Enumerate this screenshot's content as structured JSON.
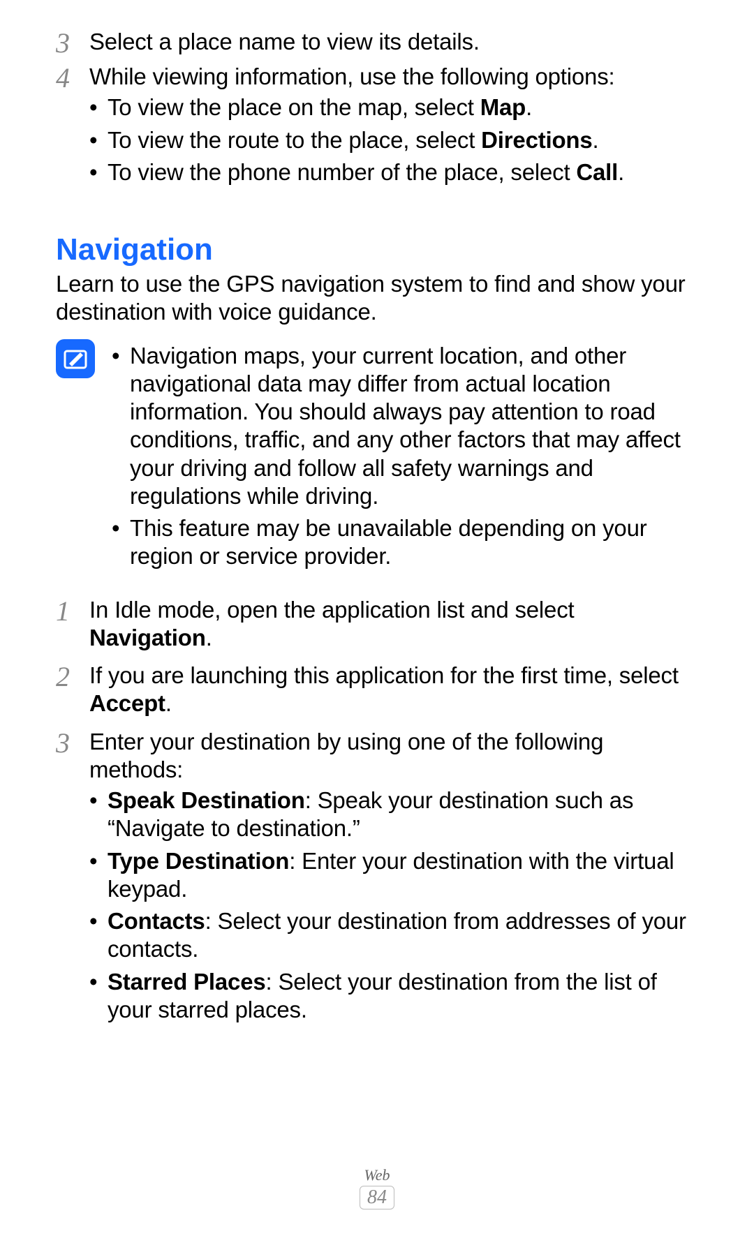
{
  "top_list": {
    "item3": {
      "num": "3",
      "text": "Select a place name to view its details."
    },
    "item4": {
      "num": "4",
      "text": "While viewing information, use the following options:",
      "bullets": {
        "b1": {
          "pre": "To view the place on the map, select ",
          "bold": "Map",
          "post": "."
        },
        "b2": {
          "pre": "To view the route to the place, select ",
          "bold": "Directions",
          "post": "."
        },
        "b3": {
          "pre": "To view the phone number of the place, select ",
          "bold": "Call",
          "post": "."
        }
      }
    }
  },
  "section": {
    "title": "Navigation",
    "intro": "Learn to use the GPS navigation system to find and show your destination with voice guidance."
  },
  "note": {
    "b1": "Navigation maps, your current location, and other navigational data may differ from actual location information. You should always pay attention to road conditions, traffic, and any other factors that may affect your driving and follow all safety warnings and regulations while driving.",
    "b2": "This feature may be unavailable depending on your region or service provider."
  },
  "steps": {
    "s1": {
      "num": "1",
      "pre": "In Idle mode, open the application list and select ",
      "bold": "Navigation",
      "post": "."
    },
    "s2": {
      "num": "2",
      "pre": "If you are launching this application for the first time, select ",
      "bold": "Accept",
      "post": "."
    },
    "s3": {
      "num": "3",
      "text": "Enter your destination by using one of the following methods:",
      "bullets": {
        "b1": {
          "bold": "Speak Destination",
          "post": ": Speak your destination such as “Navigate to destination.”"
        },
        "b2": {
          "bold": "Type Destination",
          "post": ": Enter your destination with the virtual keypad."
        },
        "b3": {
          "bold": "Contacts",
          "post": ": Select your destination from addresses of your contacts."
        },
        "b4": {
          "bold": "Starred Places",
          "post": ": Select your destination from the list of your starred places."
        }
      }
    }
  },
  "footer": {
    "section": "Web",
    "page": "84"
  }
}
